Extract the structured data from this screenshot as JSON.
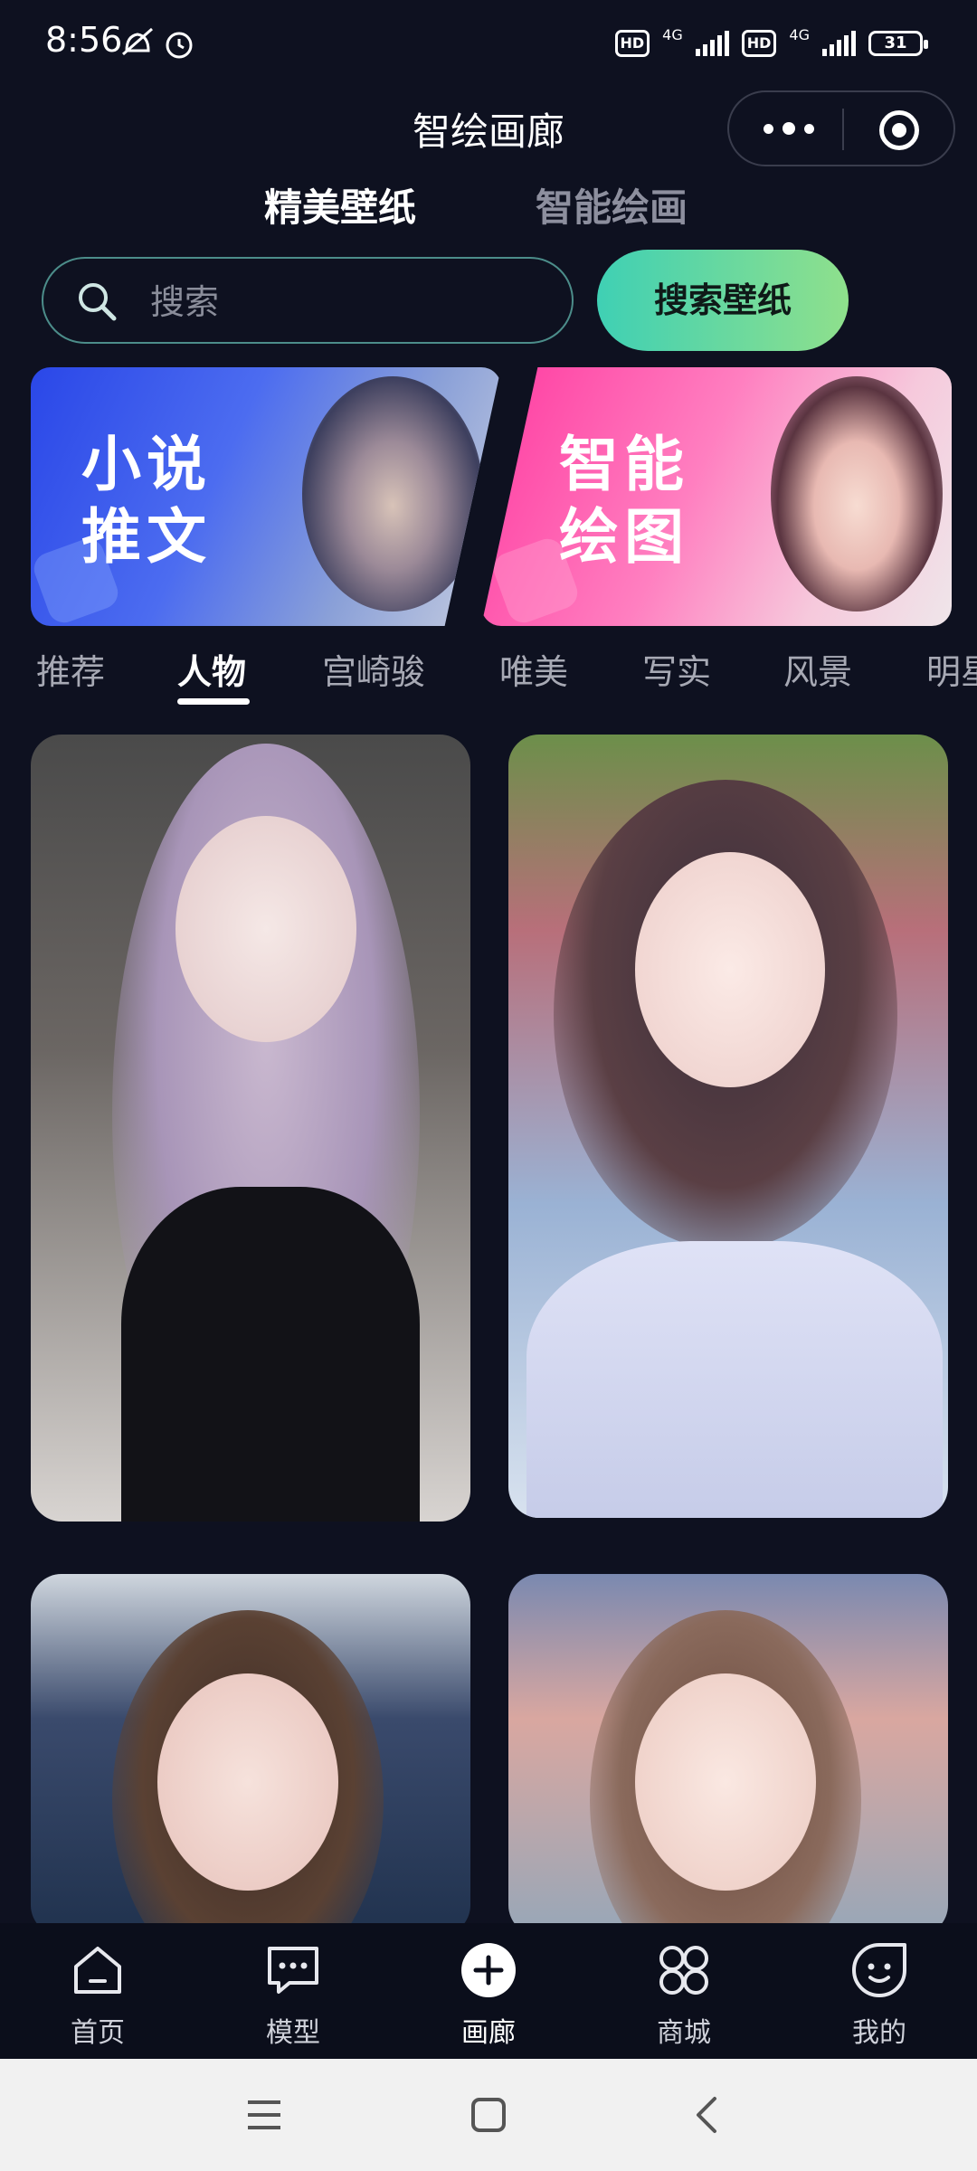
{
  "status_bar": {
    "time": "8:56",
    "hd1": "HD",
    "net1": "4G",
    "hd2": "HD",
    "net2": "4G",
    "battery": "31"
  },
  "titlebar": {
    "title": "智绘画廊"
  },
  "top_tabs": [
    {
      "label": "精美壁纸",
      "active": true
    },
    {
      "label": "智能绘画",
      "active": false
    }
  ],
  "search": {
    "placeholder": "搜索",
    "button_label": "搜索壁纸"
  },
  "banners": [
    {
      "text_line1": "小说",
      "text_line2": "推文"
    },
    {
      "text_line1": "智能",
      "text_line2": "绘图"
    }
  ],
  "categories": [
    "推荐",
    "人物",
    "宫崎骏",
    "唯美",
    "写实",
    "风景",
    "明星"
  ],
  "active_category": "人物",
  "bottom_nav": [
    {
      "label": "首页",
      "icon": "home-icon"
    },
    {
      "label": "模型",
      "icon": "chat-icon"
    },
    {
      "label": "画廊",
      "icon": "plus-circle-icon",
      "active": true
    },
    {
      "label": "商城",
      "icon": "grid-icon"
    },
    {
      "label": "我的",
      "icon": "smile-icon"
    }
  ],
  "colors": {
    "background": "#0e1120",
    "search_button_gradient": [
      "#3fd0b4",
      "#8fe08c"
    ],
    "novel_banner": "#2a47e8",
    "ai_banner": "#ff3aa0"
  }
}
